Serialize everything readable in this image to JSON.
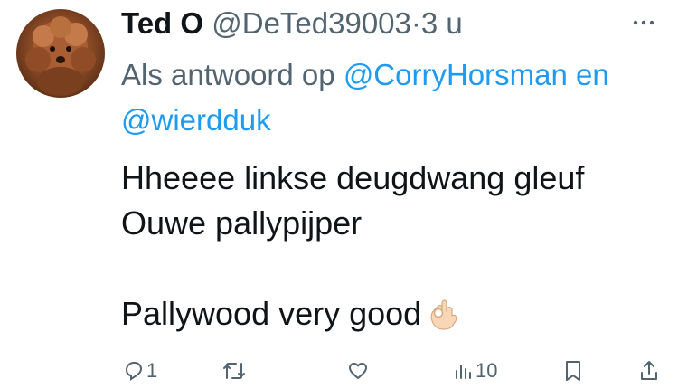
{
  "tweet": {
    "author_name": "Ted O",
    "author_handle": "@DeTed39003",
    "separator": "·",
    "time": "3 u",
    "reply_prefix": "Als antwoord op",
    "reply_mention_1": "@CorryHorsman",
    "reply_joiner": "en",
    "reply_mention_2": "@wierdduk",
    "line1": "Hheeee linkse deugdwang gleuf",
    "line2": "Ouwe pallypijper",
    "line3": "Pallywood very good",
    "emoji": "ok-hand-emoji"
  },
  "actions": {
    "reply_count": "1",
    "retweet_count": "",
    "like_count": "",
    "views_count": "10"
  },
  "colors": {
    "text": "#0f1419",
    "muted": "#536471",
    "link": "#1d9bf0"
  }
}
